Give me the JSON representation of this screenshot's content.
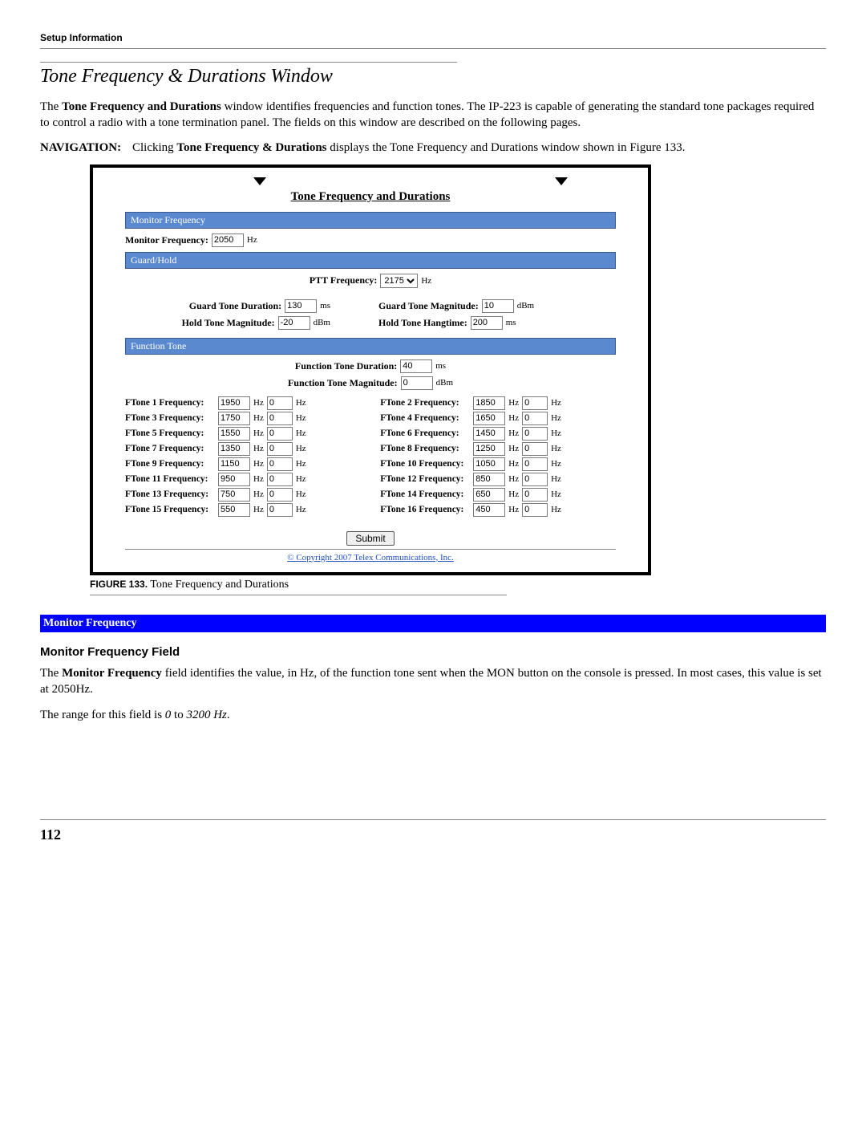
{
  "header": {
    "label": "Setup Information"
  },
  "section_title": "Tone Frequency & Durations Window",
  "intro": {
    "p1_pre": "The ",
    "p1_bold": "Tone Frequency and Durations",
    "p1_post": " window identifies frequencies and function tones. The IP-223 is capable of generating the standard tone packages required to control a radio with a tone termination panel. The fields on this window are described on the following pages."
  },
  "navigation": {
    "label": "NAVIGATION:",
    "text_pre": "Clicking ",
    "text_bold": "Tone Frequency & Durations",
    "text_post": " displays the Tone Frequency and Durations window shown in Figure 133."
  },
  "figure": {
    "title": "Tone Frequency and Durations",
    "sections": {
      "monitor": {
        "bar": "Monitor Frequency",
        "label": "Monitor Frequency:",
        "value": "2050",
        "unit": "Hz"
      },
      "guardhold": {
        "bar": "Guard/Hold",
        "ptt_label": "PTT Frequency:",
        "ptt_value": "2175",
        "ptt_unit": "Hz",
        "gtd_label": "Guard Tone Duration:",
        "gtd_value": "130",
        "gtd_unit": "ms",
        "gtm_label": "Guard Tone Magnitude:",
        "gtm_value": "10",
        "gtm_unit": "dBm",
        "htm_label": "Hold Tone Magnitude:",
        "htm_value": "-20",
        "htm_unit": "dBm",
        "hth_label": "Hold Tone Hangtime:",
        "hth_value": "200",
        "hth_unit": "ms"
      },
      "functiontone": {
        "bar": "Function Tone",
        "ftd_label": "Function Tone Duration:",
        "ftd_value": "40",
        "ftd_unit": "ms",
        "ftm_label": "Function Tone Magnitude:",
        "ftm_value": "0",
        "ftm_unit": "dBm",
        "rows": [
          {
            "ll": "FTone 1 Frequency:",
            "lv": "1950",
            "l2": "0",
            "rl": "FTone 2 Frequency:",
            "rv": "1850",
            "r2": "0"
          },
          {
            "ll": "FTone 3 Frequency:",
            "lv": "1750",
            "l2": "0",
            "rl": "FTone 4 Frequency:",
            "rv": "1650",
            "r2": "0"
          },
          {
            "ll": "FTone 5 Frequency:",
            "lv": "1550",
            "l2": "0",
            "rl": "FTone 6 Frequency:",
            "rv": "1450",
            "r2": "0"
          },
          {
            "ll": "FTone 7 Frequency:",
            "lv": "1350",
            "l2": "0",
            "rl": "FTone 8 Frequency:",
            "rv": "1250",
            "r2": "0"
          },
          {
            "ll": "FTone 9 Frequency:",
            "lv": "1150",
            "l2": "0",
            "rl": "FTone 10 Frequency:",
            "rv": "1050",
            "r2": "0"
          },
          {
            "ll": "FTone 11 Frequency:",
            "lv": "950",
            "l2": "0",
            "rl": "FTone 12 Frequency:",
            "rv": "850",
            "r2": "0"
          },
          {
            "ll": "FTone 13 Frequency:",
            "lv": "750",
            "l2": "0",
            "rl": "FTone 14 Frequency:",
            "rv": "650",
            "r2": "0"
          },
          {
            "ll": "FTone 15 Frequency:",
            "lv": "550",
            "l2": "0",
            "rl": "FTone 16 Frequency:",
            "rv": "450",
            "r2": "0"
          }
        ],
        "hz": "Hz"
      }
    },
    "submit": "Submit",
    "copyright": "© Copyright 2007 Telex Communications, Inc.",
    "caption_num": "FIGURE 133.",
    "caption_text": " Tone Frequency and Durations"
  },
  "blue_heading": "Monitor Frequency",
  "mf_field": {
    "heading": "Monitor Frequency Field",
    "p1_pre": "The ",
    "p1_bold": "Monitor Frequency",
    "p1_post": " field identifies the value, in Hz, of the function tone sent when the MON button on the console is pressed. In most cases, this value is set at 2050Hz.",
    "p2_pre": "The range for this field is ",
    "p2_ital": "0",
    "p2_mid": " to ",
    "p2_ital2": "3200 Hz",
    "p2_post": "."
  },
  "page_number": "112"
}
